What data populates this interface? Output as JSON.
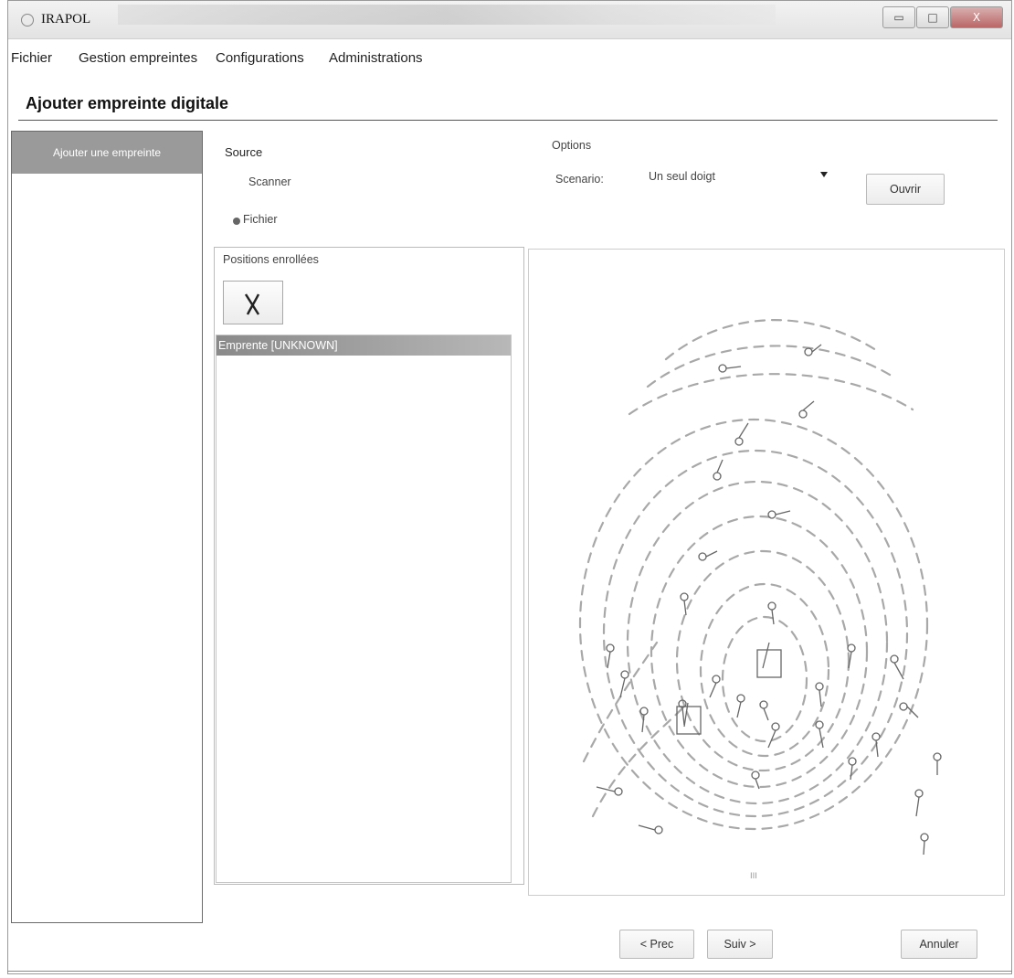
{
  "window": {
    "title": "IRAPOL",
    "minimize_label": "▭",
    "maximize_label": "□",
    "close_label": "X"
  },
  "menu": [
    "Fichier",
    "Gestion empreintes",
    "Configurations",
    "Administrations"
  ],
  "page_title": "Ajouter empreinte digitale",
  "nav": {
    "items": [
      "Ajouter une empreinte"
    ]
  },
  "source": {
    "label": "Source",
    "options": [
      "Scanner",
      "Fichier"
    ],
    "selected": "Fichier"
  },
  "options": {
    "label": "Options",
    "scenario_label": "Scenario:",
    "scenario_value": "Un seul doigt",
    "open_button": "Ouvrir"
  },
  "positions": {
    "label": "Positions enrollées",
    "delete_icon": "x-icon",
    "list": [
      "Emprente [UNKNOWN]"
    ]
  },
  "preview": {
    "scroll_marker": "III"
  },
  "buttons": {
    "prev": "< Prec",
    "next": "Suiv >",
    "cancel": "Annuler"
  },
  "colors": {
    "selection": "#9a9a9a",
    "border": "#6a6a6a"
  }
}
